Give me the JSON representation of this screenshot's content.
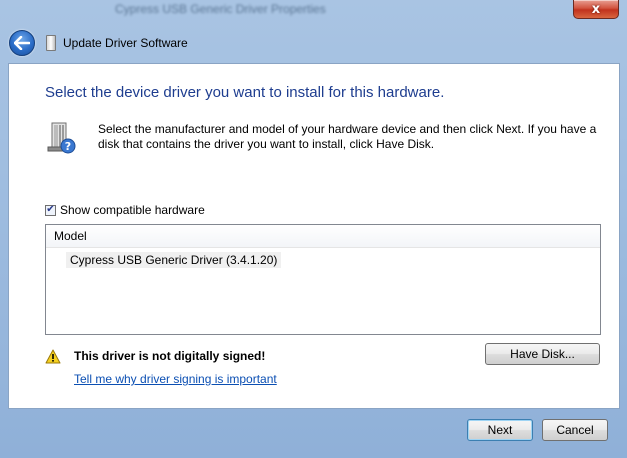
{
  "background_window": {
    "title": "Cypress USB Generic Driver Properties"
  },
  "titlebar": {
    "title": "Update Driver Software",
    "close_label": "x"
  },
  "main": {
    "heading": "Select the device driver you want to install for this hardware.",
    "description": "Select the manufacturer and model of your hardware device and then click Next. If you have a disk that contains the driver you want to install, click Have Disk.",
    "show_compatible": {
      "label": "Show compatible hardware",
      "checked": true
    },
    "model_list": {
      "header": "Model",
      "items": [
        "Cypress USB Generic Driver (3.4.1.20)"
      ]
    },
    "warning": "This driver is not digitally signed!",
    "link": "Tell me why driver signing is important",
    "have_disk_label": "Have Disk..."
  },
  "footer": {
    "next_label": "Next",
    "cancel_label": "Cancel"
  },
  "colors": {
    "heading": "#1e3d8f",
    "link": "#0b4fb3",
    "close_red": "#c1321d"
  }
}
